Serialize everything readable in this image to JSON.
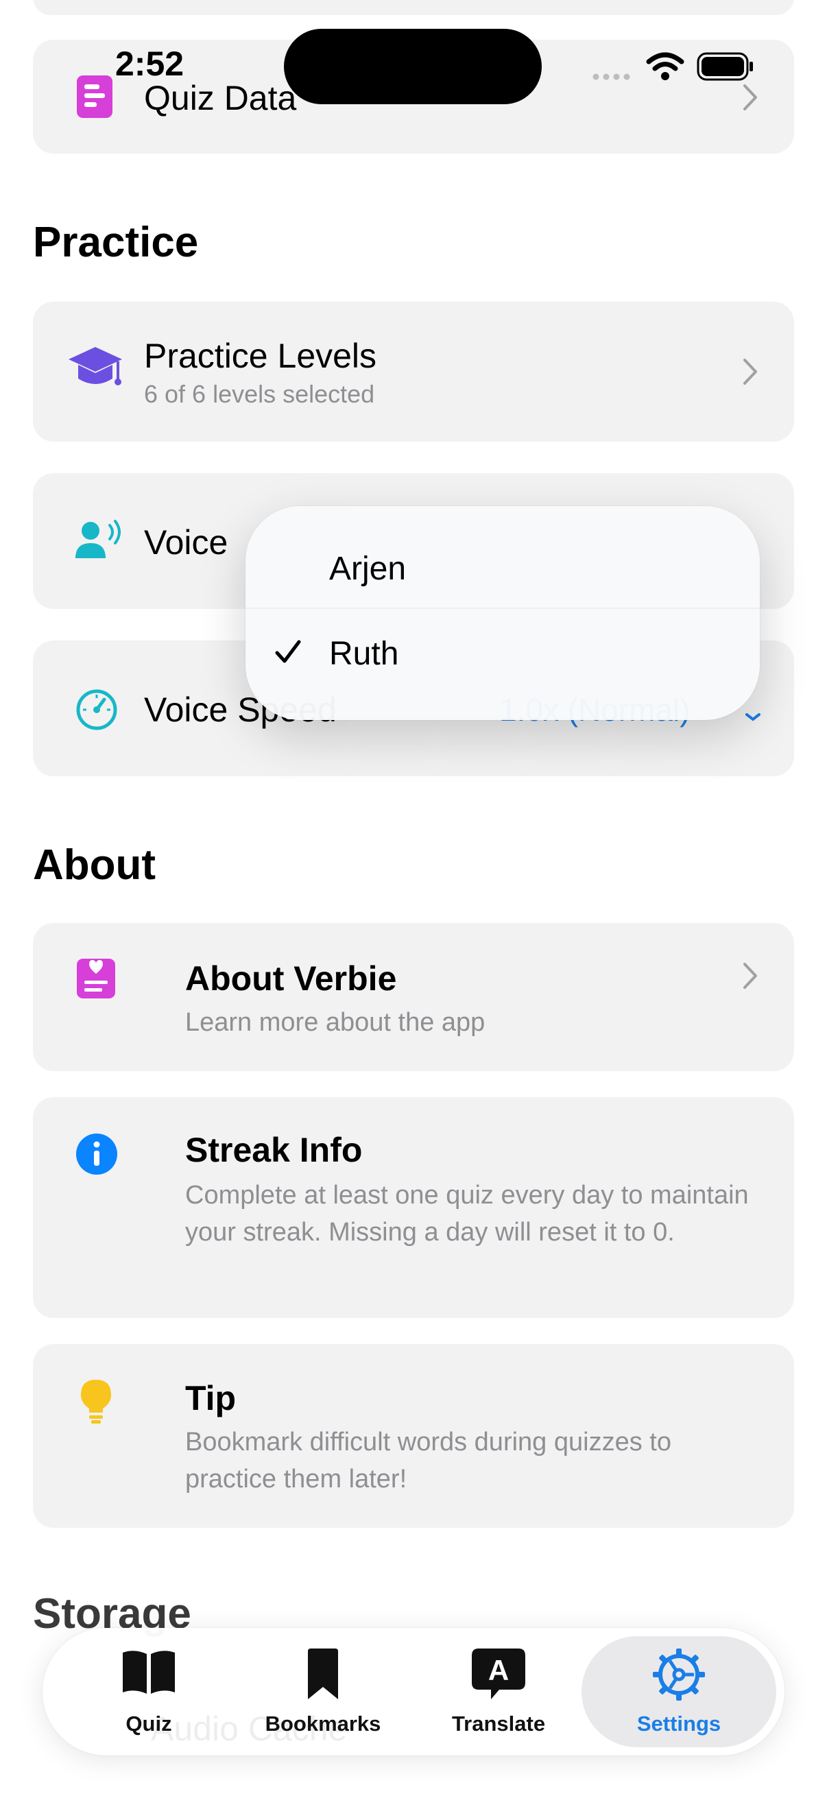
{
  "status_bar": {
    "time": "2:52"
  },
  "quiz_data_row": {
    "label": "Quiz Data"
  },
  "practice_section": {
    "heading": "Practice",
    "levels": {
      "title": "Practice Levels",
      "subtitle": "6 of 6 levels selected"
    },
    "voice": {
      "label": "Voice"
    },
    "voice_speed": {
      "label": "Voice Speed",
      "value": "1.0x (Normal)"
    }
  },
  "voice_menu": {
    "options": [
      "Arjen",
      "Ruth"
    ],
    "selected": "Ruth"
  },
  "about_section": {
    "heading": "About",
    "about_app": {
      "title": "About Verbie",
      "subtitle": "Learn more about the app"
    },
    "streak": {
      "title": "Streak Info",
      "body": "Complete at least one quiz every day to maintain your streak. Missing a day will reset it to 0."
    },
    "tip": {
      "title": "Tip",
      "body": "Bookmark difficult words during quizzes to practice them later!"
    }
  },
  "storage_section": {
    "heading": "Storage",
    "audio_cache_label": "Audio Cache"
  },
  "tab_bar": {
    "tabs": [
      {
        "label": "Quiz",
        "icon": "book-icon"
      },
      {
        "label": "Bookmarks",
        "icon": "bookmark-icon"
      },
      {
        "label": "Translate",
        "icon": "translate-icon"
      },
      {
        "label": "Settings",
        "icon": "gear-icon"
      }
    ],
    "selected": "Settings"
  },
  "colors": {
    "accent": "#1a7ee6",
    "magenta_icon": "#d63fd8",
    "teal_icon": "#17b7c8",
    "purple_icon": "#6b4fe0",
    "info_blue": "#0a84ff",
    "tip_yellow": "#f7c51d",
    "card_bg": "#f2f2f2",
    "secondary_text": "#8e8e93"
  }
}
